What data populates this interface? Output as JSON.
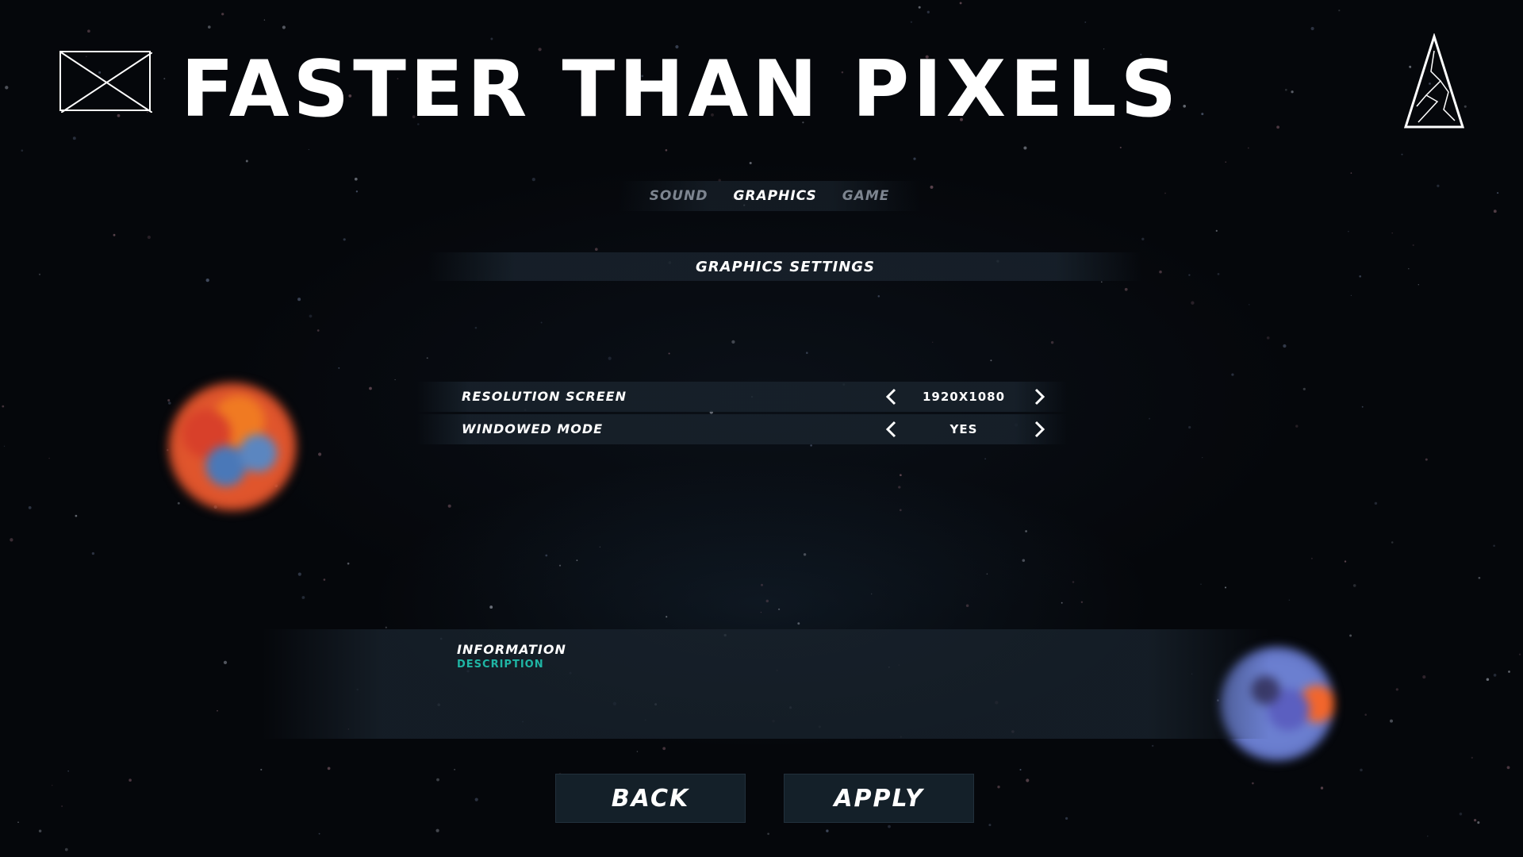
{
  "title": "FASTER THAN PIXELS",
  "tabs": [
    {
      "label": "SOUND",
      "active": false
    },
    {
      "label": "GRAPHICS",
      "active": true
    },
    {
      "label": "GAME",
      "active": false
    }
  ],
  "section": {
    "title": "GRAPHICS SETTINGS"
  },
  "settings": [
    {
      "label": "RESOLUTION SCREEN",
      "value": "1920X1080"
    },
    {
      "label": "WINDOWED MODE",
      "value": "YES"
    }
  ],
  "info": {
    "title": "INFORMATION",
    "description": "DESCRIPTION"
  },
  "buttons": {
    "back": "BACK",
    "apply": "APPLY"
  },
  "colors": {
    "accent": "#1fb5a4",
    "text": "#ffffff",
    "inactive_tab": "#7d8590",
    "panel": "#142029"
  }
}
